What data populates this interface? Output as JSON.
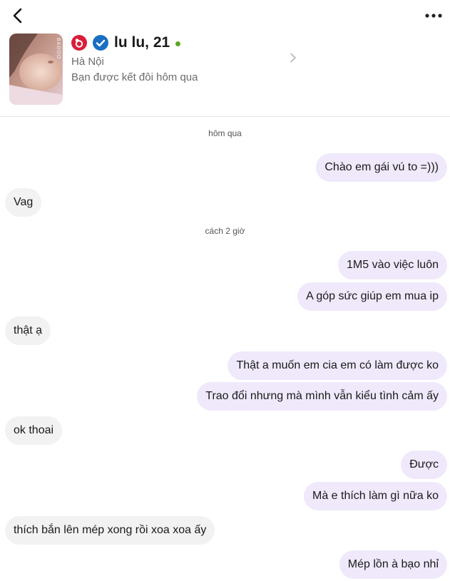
{
  "profile": {
    "name": "lu lu, 21",
    "city": "Hà Nội",
    "matched_text": "Bạn được kết đôi hôm qua",
    "photo_watermark": "BADOO"
  },
  "colors": {
    "outgoing_bubble": "#efe9fb",
    "incoming_bubble": "#f2f2f2",
    "online_dot": "#5aa623",
    "verified_badge": "#1a6fc1",
    "app_badge": "#d91e3a"
  },
  "icons": {
    "back": "chevron-left-icon",
    "more": "more-options-icon",
    "app_badge": "badoo-badge-icon",
    "verified": "verified-check-icon",
    "open_profile": "chevron-right-icon"
  },
  "timestamps": {
    "first": "hôm qua",
    "second": "cách 2 giờ"
  },
  "messages": [
    {
      "from": "me",
      "text": "Chào em gái vú to =)))"
    },
    {
      "from": "them",
      "text": "Vag"
    },
    {
      "from": "me",
      "text": "1M5 vào việc luôn"
    },
    {
      "from": "me",
      "text": "A góp sức giúp em mua ip"
    },
    {
      "from": "them",
      "text": "thật ạ"
    },
    {
      "from": "me",
      "text": "Thật a muốn em cia em có làm được ko"
    },
    {
      "from": "me",
      "text": "Trao đổi nhưng mà mình vẫn kiểu tình cảm ấy"
    },
    {
      "from": "them",
      "text": "ok thoai"
    },
    {
      "from": "me",
      "text": "Được"
    },
    {
      "from": "me",
      "text": "Mà e thích làm gì nữa ko"
    },
    {
      "from": "them",
      "text": "thích bắn lên mép xong rồi xoa xoa ấy"
    },
    {
      "from": "me",
      "text": "Mép lồn à bạo nhỉ"
    }
  ]
}
